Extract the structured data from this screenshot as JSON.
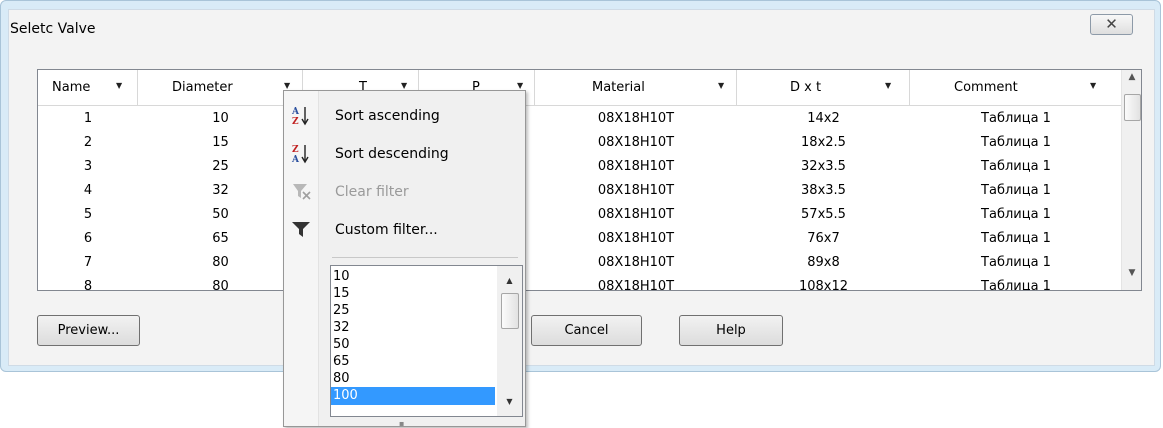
{
  "window": {
    "title": "Seletc Valve",
    "close_icon": "close-icon"
  },
  "grid": {
    "columns": [
      {
        "id": "name",
        "label": "Name"
      },
      {
        "id": "diameter",
        "label": "Diameter"
      },
      {
        "id": "t",
        "label": "T"
      },
      {
        "id": "p",
        "label": "P"
      },
      {
        "id": "material",
        "label": "Material"
      },
      {
        "id": "dxt",
        "label": "D x t"
      },
      {
        "id": "comment",
        "label": "Comment"
      }
    ],
    "rows": [
      {
        "name": "1",
        "diameter": "10",
        "material": "08X18H10T",
        "dxt": "14x2",
        "comment": "Таблица 1"
      },
      {
        "name": "2",
        "diameter": "15",
        "material": "08X18H10T",
        "dxt": "18x2.5",
        "comment": "Таблица 1"
      },
      {
        "name": "3",
        "diameter": "25",
        "material": "08X18H10T",
        "dxt": "32x3.5",
        "comment": "Таблица 1"
      },
      {
        "name": "4",
        "diameter": "32",
        "material": "08X18H10T",
        "dxt": "38x3.5",
        "comment": "Таблица 1"
      },
      {
        "name": "5",
        "diameter": "50",
        "material": "08X18H10T",
        "dxt": "57x5.5",
        "comment": "Таблица 1"
      },
      {
        "name": "6",
        "diameter": "65",
        "material": "08X18H10T",
        "dxt": "76x7",
        "comment": "Таблица 1"
      },
      {
        "name": "7",
        "diameter": "80",
        "material": "08X18H10T",
        "dxt": "89x8",
        "comment": "Таблица 1"
      },
      {
        "name": "8",
        "diameter": "80",
        "material": "08X18H10T",
        "dxt": "108x12",
        "comment": "Таблица 1"
      }
    ]
  },
  "buttons": {
    "preview": "Preview...",
    "cancel": "Cancel",
    "help": "Help"
  },
  "filter_menu": {
    "items": [
      {
        "label": "Sort ascending",
        "icon": "sort-ascending-icon",
        "enabled": true
      },
      {
        "label": "Sort descending",
        "icon": "sort-descending-icon",
        "enabled": true
      },
      {
        "label": "Clear filter",
        "icon": "clear-filter-icon",
        "enabled": false
      },
      {
        "label": "Custom filter...",
        "icon": "filter-icon",
        "enabled": true
      }
    ],
    "values": [
      "10",
      "15",
      "25",
      "32",
      "50",
      "65",
      "80",
      "100"
    ],
    "selected_value": "100"
  },
  "colors": {
    "selection": "#3399ff",
    "dialog_frame": "#d9ebf7"
  }
}
